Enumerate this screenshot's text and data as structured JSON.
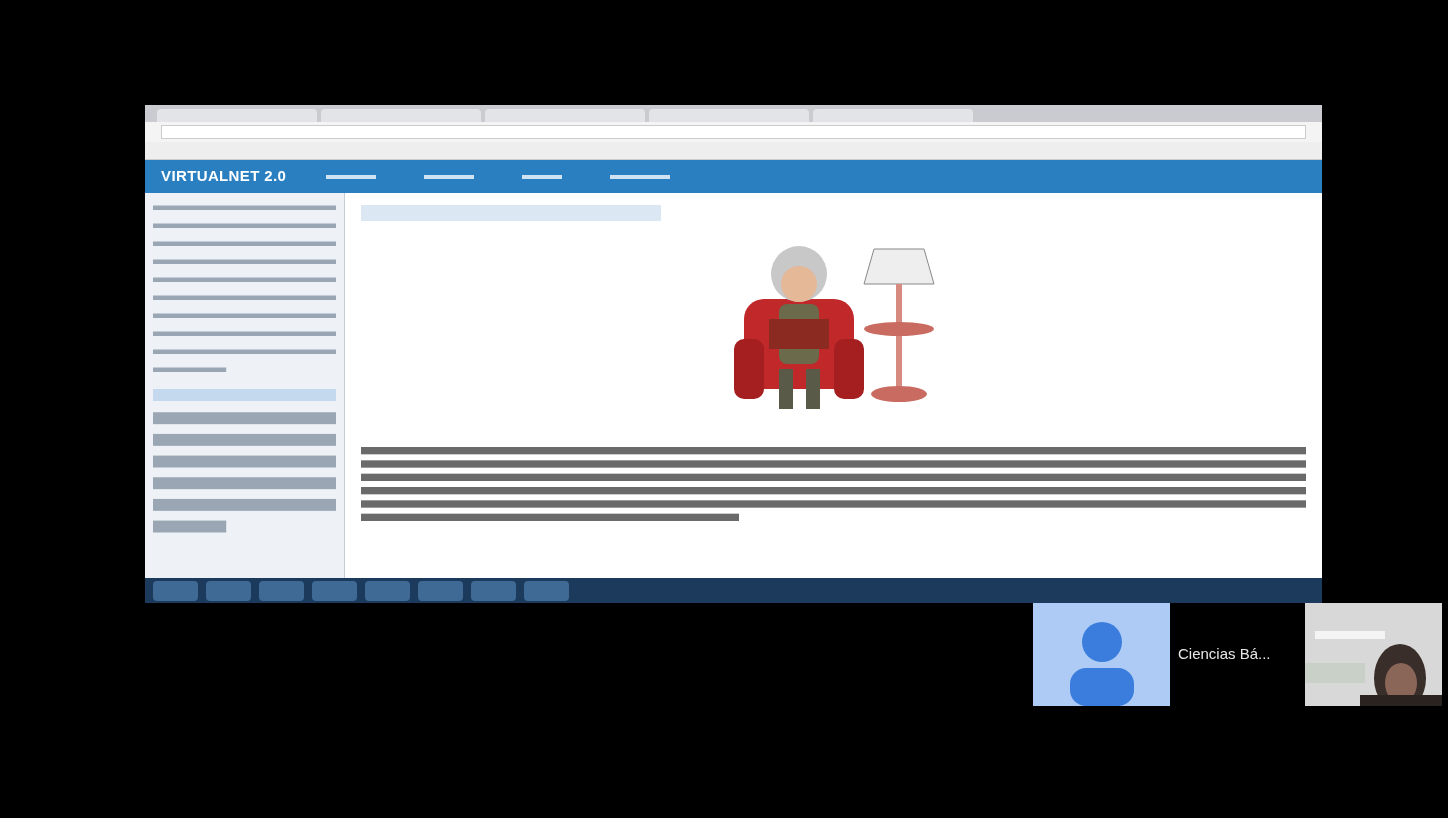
{
  "shared_screen": {
    "brand": "VIRTUALNET 2.0"
  },
  "participants": [
    {
      "kind": "avatar",
      "name": "Ciencias Bá..."
    },
    {
      "kind": "camera"
    }
  ]
}
